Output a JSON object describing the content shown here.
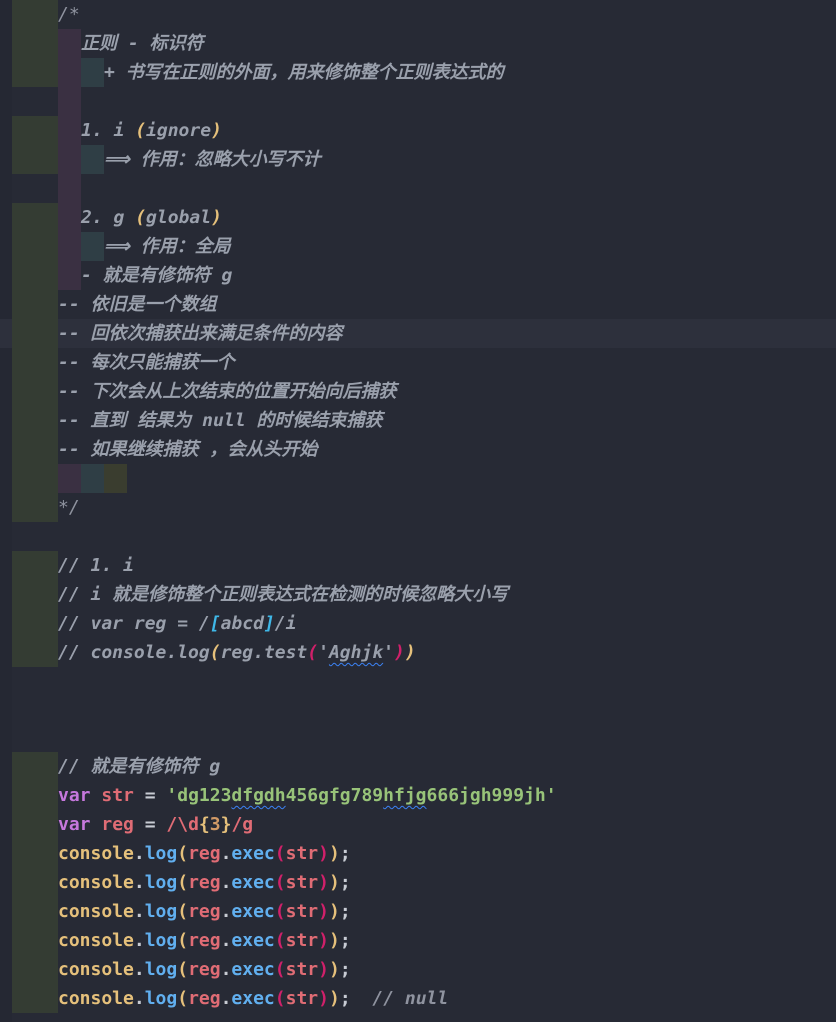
{
  "editor": {
    "language": "javascript",
    "colors": {
      "background": "#272a35",
      "comment": "#8f939f",
      "keyword": "#c678dd",
      "variable": "#e06c75",
      "string": "#98c379",
      "function": "#e5c07b",
      "method": "#61afef"
    }
  },
  "lines": {
    "l1": "/*",
    "l2": "正则 - 标识符",
    "l3": "+ 书写在正则的外面，用来修饰整个正则表达式的",
    "l5_a": "1. i ",
    "l5_b": "(",
    "l5_c": "ignore",
    "l5_d": ")",
    "l6": "⟹ 作用：忽略大小写不计",
    "l8_a": "2. g ",
    "l8_b": "(",
    "l8_c": "global",
    "l8_d": ")",
    "l9": "⟹ 作用：全局",
    "l10": "- 就是有修饰符 g",
    "l11": "-- 依旧是一个数组",
    "l12": "-- 回依次捕获出来满足条件的内容",
    "l13": "-- 每次只能捕获一个",
    "l14": "-- 下次会从上次结束的位置开始向后捕获",
    "l15": "-- 直到 结果为 null 的时候结束捕获",
    "l16": "-- 如果继续捕获 ，会从头开始",
    "l18": "*/",
    "l20": "// 1. i",
    "l21": "// i 就是修饰整个正则表达式在检测的时候忽略大小写",
    "l22_a": "// var reg = /",
    "l22_b": "[",
    "l22_c": "abcd",
    "l22_d": "]",
    "l22_e": "/i",
    "l23_a": "// console.log",
    "l23_b": "(",
    "l23_c": "reg.test",
    "l23_d": "(",
    "l23_e": "'",
    "l23_f": "Aghjk",
    "l23_g": "'",
    "l23_h": ")",
    "l23_i": ")",
    "l27": "// 就是有修饰符 g",
    "l28_kw": "var",
    "l28_var": "str",
    "l28_eq": " = ",
    "l28_str1": "'dg123",
    "l28_str2": "dfgdh",
    "l28_str3": "456gfg789",
    "l28_str4": "hfjg",
    "l28_str5": "666jgh999jh'",
    "l29_kw": "var",
    "l29_var": "reg",
    "l29_eq": " = ",
    "l29_rx1": "/\\d",
    "l29_b1": "{",
    "l29_num": "3",
    "l29_b2": "}",
    "l29_rx2": "/g",
    "call_console": "console",
    "call_dot": ".",
    "call_log": "log",
    "call_p1": "(",
    "call_reg": "reg",
    "call_dot2": ".",
    "call_exec": "exec",
    "call_p2": "(",
    "call_str": "str",
    "call_p3": ")",
    "call_p4": ")",
    "call_semi": ";",
    "l35_comment": "// null"
  }
}
